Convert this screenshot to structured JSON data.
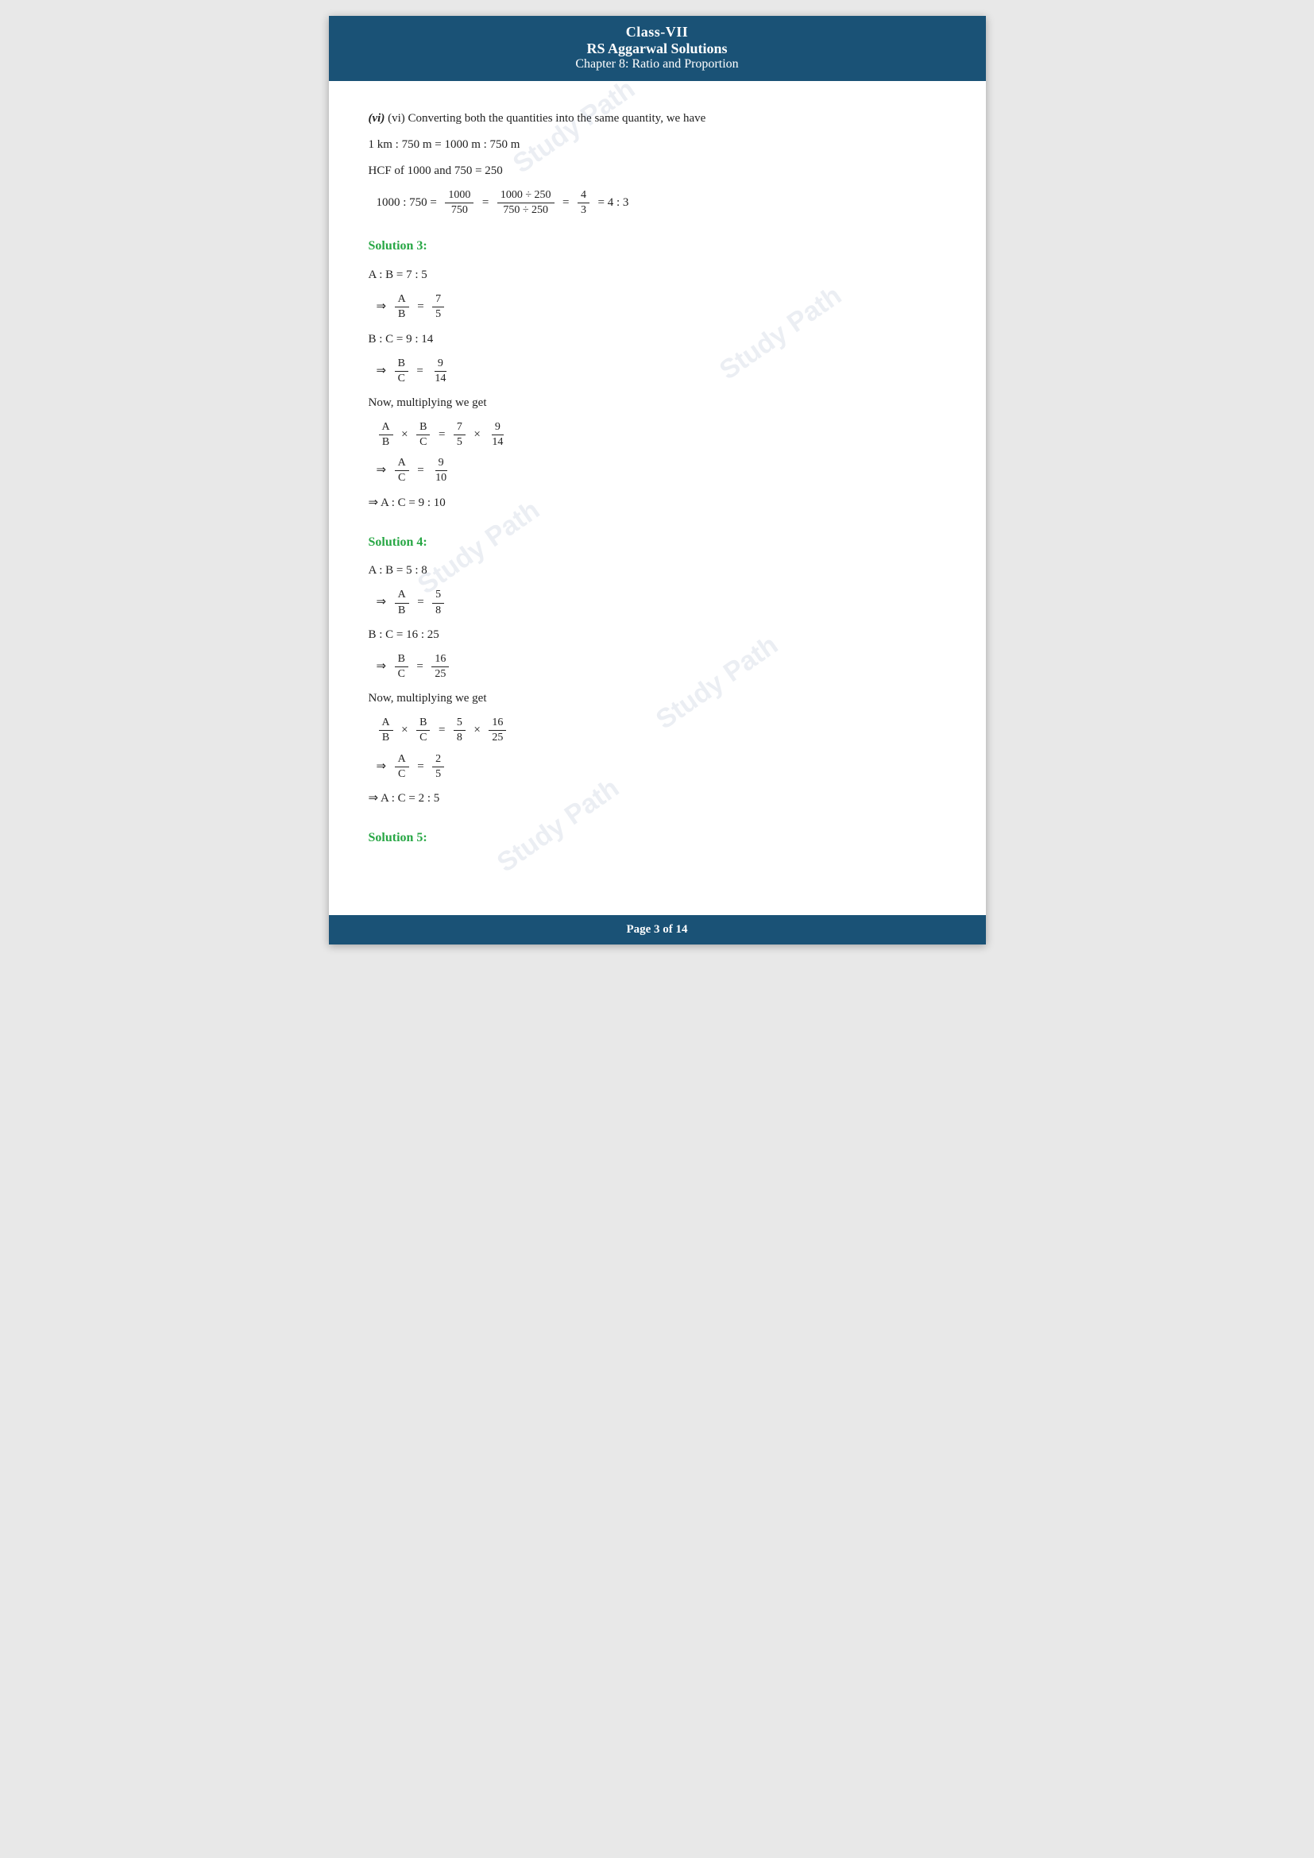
{
  "header": {
    "class_label": "Class-VII",
    "title": "RS Aggarwal Solutions",
    "chapter": "Chapter 8: Ratio and Proportion"
  },
  "footer": {
    "page_info": "Page 3 of 14"
  },
  "content": {
    "vi_intro": "(vi) Converting both the quantities into the same quantity, we have",
    "vi_step1": "1 km : 750 m = 1000 m : 750 m",
    "vi_hcf": "HCF of 1000 and 750 = 250",
    "solution3_heading": "Solution 3:",
    "solution3_lines": [
      "A : B = 7 : 5",
      "B : C = 9 : 14",
      "Now, multiplying we get",
      "⇒ A : C = 9 : 10"
    ],
    "solution4_heading": "Solution 4:",
    "solution4_lines": [
      "A : B = 5 : 8",
      "B : C = 16 : 25",
      "Now, multiplying we get",
      "⇒ A : C = 2 : 5"
    ],
    "solution5_heading": "Solution 5:"
  },
  "watermarks": [
    "Study\nPath",
    "Study\nPath",
    "Study\nPath"
  ]
}
